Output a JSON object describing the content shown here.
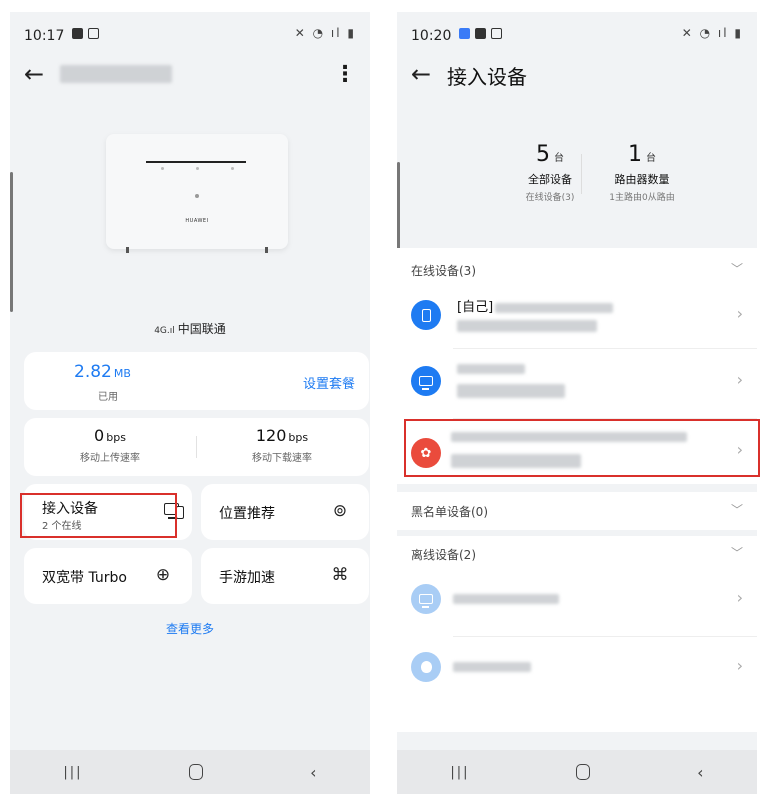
{
  "left_screen": {
    "status_time": "10:17",
    "carrier": "中国联通",
    "signal_badge": "4G",
    "usage": {
      "value": "2.82",
      "unit": "MB",
      "label": "已用",
      "plan_link": "设置套餐"
    },
    "upload": {
      "value": "0",
      "unit": "bps",
      "label": "移动上传速率"
    },
    "download": {
      "value": "120",
      "unit": "bps",
      "label": "移动下载速率"
    },
    "tiles": [
      {
        "label": "接入设备",
        "sub": "2 个在线",
        "icon": "devices-icon"
      },
      {
        "label": "位置推荐",
        "icon": "location-recommend-icon"
      },
      {
        "label": "双宽带 Turbo",
        "icon": "turbo-icon"
      },
      {
        "label": "手游加速",
        "icon": "gamepad-icon"
      }
    ],
    "more_link": "查看更多",
    "router_brand": "HUAWEI"
  },
  "right_screen": {
    "status_time": "10:20",
    "title": "接入设备",
    "stats": [
      {
        "num": "5",
        "unit": "台",
        "name": "全部设备",
        "sub": "在线设备(3)"
      },
      {
        "num": "1",
        "unit": "台",
        "name": "路由器数量",
        "sub": "1主路由0从路由"
      }
    ],
    "sections": {
      "online": "在线设备(3)",
      "blacklist": "黑名单设备(0)",
      "offline": "离线设备(2)"
    },
    "self_prefix": "[自己]",
    "colors": {
      "blue": "#1e7bf2",
      "huawei_red": "#ea4b3c",
      "light_blue": "#a9cdf5"
    }
  }
}
